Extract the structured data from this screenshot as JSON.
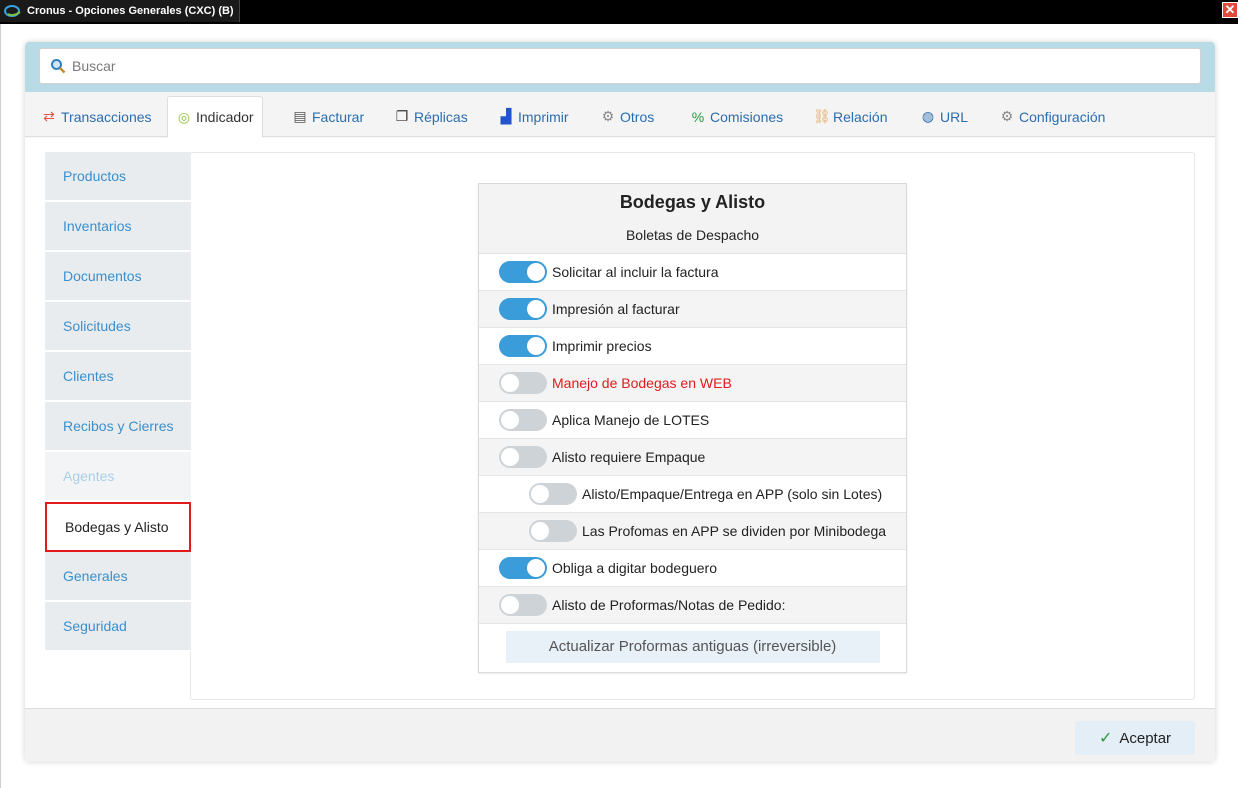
{
  "window": {
    "title": "Cronus - Opciones Generales (CXC) (B)",
    "close_symbol": "✕"
  },
  "search": {
    "placeholder": "Buscar"
  },
  "tabs": [
    {
      "label": "Transacciones",
      "icon": "swap-arrows-icon",
      "glyph": "⇄",
      "color": "#e2574c"
    },
    {
      "label": "Indicador",
      "icon": "target-icon",
      "glyph": "◎",
      "color": "#8dbf3a"
    },
    {
      "label": "Facturar",
      "icon": "document-icon",
      "glyph": "▤",
      "color": "#555555"
    },
    {
      "label": "Réplicas",
      "icon": "copy-icon",
      "glyph": "❐",
      "color": "#333333"
    },
    {
      "label": "Imprimir",
      "icon": "chart-icon",
      "glyph": "▟",
      "color": "#2255cc"
    },
    {
      "label": "Otros",
      "icon": "gears-icon",
      "glyph": "⚙",
      "color": "#888888"
    },
    {
      "label": "Comisiones",
      "icon": "percent-icon",
      "glyph": "%",
      "color": "#1f9a3a"
    },
    {
      "label": "Relación",
      "icon": "link-icon",
      "glyph": "⛓",
      "color": "#e2a860"
    },
    {
      "label": "URL",
      "icon": "globe-icon",
      "glyph": "◍",
      "color": "#2a6db0"
    },
    {
      "label": "Configuración",
      "icon": "gear-icon",
      "glyph": "⚙",
      "color": "#888888"
    }
  ],
  "active_tab": "Indicador",
  "sidebar": {
    "items": [
      {
        "label": "Productos"
      },
      {
        "label": "Inventarios"
      },
      {
        "label": "Documentos"
      },
      {
        "label": "Solicitudes"
      },
      {
        "label": "Clientes"
      },
      {
        "label": "Recibos y Cierres"
      },
      {
        "label": "Agentes"
      },
      {
        "label": "Bodegas y Alisto"
      },
      {
        "label": "Generales"
      },
      {
        "label": "Seguridad"
      }
    ],
    "selected": "Bodegas y Alisto",
    "disabled": "Agentes"
  },
  "panel": {
    "title": "Bodegas y Alisto",
    "subtitle": "Boletas de Despacho",
    "options": [
      {
        "label": "Solicitar al incluir la factura",
        "on": true
      },
      {
        "label": "Impresión al facturar",
        "on": true
      },
      {
        "label": "Imprimir precios",
        "on": true
      },
      {
        "label": "Manejo de Bodegas en WEB",
        "on": false,
        "color": "#e11b1b"
      },
      {
        "label": "Aplica Manejo de LOTES",
        "on": false
      },
      {
        "label": "Alisto requiere Empaque",
        "on": false
      },
      {
        "label": "Alisto/Empaque/Entrega en APP (solo sin Lotes)",
        "on": false,
        "indented": true
      },
      {
        "label": "Las Profomas en APP se dividen por Minibodega",
        "on": false,
        "indented": true
      },
      {
        "label": "Obliga a digitar bodeguero",
        "on": true
      },
      {
        "label": "Alisto de Proformas/Notas de Pedido:",
        "on": false
      }
    ],
    "action_label": "Actualizar Proformas antiguas (irreversible)"
  },
  "footer": {
    "accept_label": "Aceptar",
    "accept_icon": "check-icon"
  },
  "colors": {
    "accent": "#3a9cd8",
    "link": "#2a6db0",
    "search_band": "#b8dbe6",
    "highlight": "#e11b1b"
  }
}
